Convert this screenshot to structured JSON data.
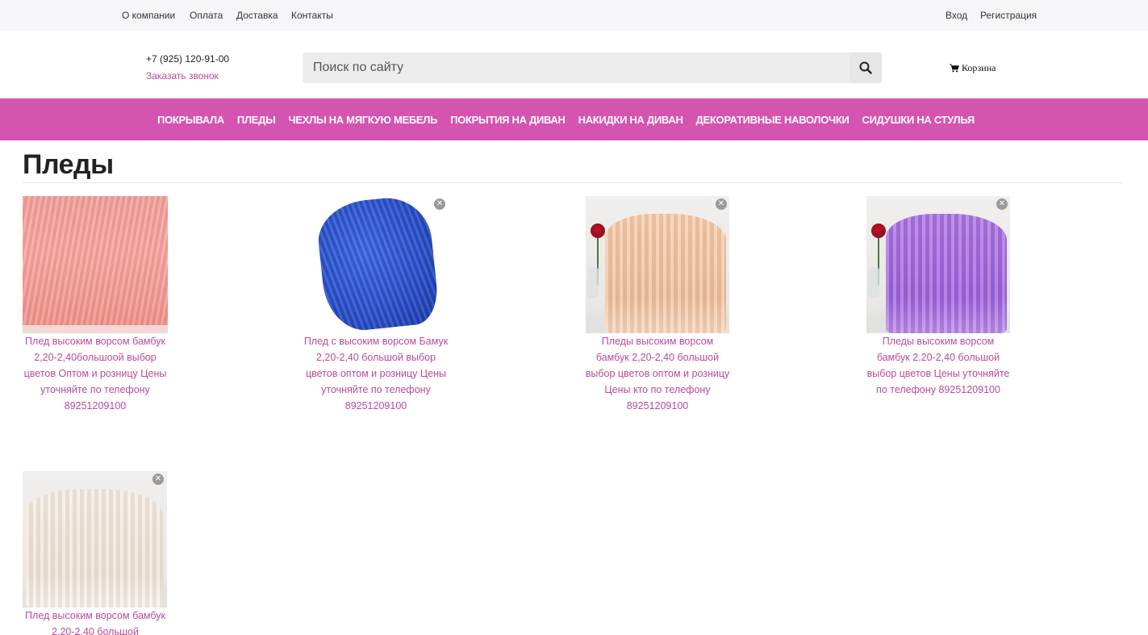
{
  "topbar": {
    "links": [
      "О компании",
      "Оплата",
      "Доставка",
      "Контакты"
    ],
    "login": "Вход",
    "register": "Регистрация"
  },
  "header": {
    "phone": "+7 (925) 120-91-00",
    "callback": "Заказать звонок",
    "search_placeholder": "Поиск по сайту",
    "cart": "Корзина"
  },
  "nav": {
    "items": [
      "ПОКРЫВАЛА",
      "ПЛЕДЫ",
      "ЧЕХЛЫ НА МЯГКУЮ МЕБЕЛЬ",
      "ПОКРЫТИЯ НА ДИВАН",
      "НАКИДКИ НА ДИВАН",
      "ДЕКОРАТИВНЫЕ НАВОЛОЧКИ",
      "СИДУШКИ НА СТУЛЬЯ"
    ]
  },
  "page": {
    "title": "Пледы"
  },
  "products": [
    {
      "caption": "Плед высоким ворсом бамбук 2,20-2,40большоой выбор цветов Оптом и розницу Цены уточняйте по телефону 89251209100",
      "image": "pink-blanket"
    },
    {
      "caption": "Плед с высоким ворсом Бамук 2,20-2,40 большой выбор цветов оптом и розницу Цены уточняйте по телефону 89251209100",
      "image": "blue-blanket"
    },
    {
      "caption": "Пледы высоким ворсом бамбук 2,20-2,40 большой выбор цветов оптом и розницу Цены кто по телефону 89251209100",
      "image": "peach-blanket"
    },
    {
      "caption": "Пледы высоким ворсом бамбук 2.20-2,40 большой выбор цветов Цены уточняйте по телефону 89251209100",
      "image": "violet-blanket"
    },
    {
      "caption": "Плед высоким ворсом бамбук 2,20-2,40 большой",
      "image": "cream-blanket"
    }
  ],
  "colors": {
    "accent": "#d454b0",
    "link": "#b94a9e",
    "topbar_bg": "#f6f6f8"
  },
  "icons": {
    "search": "search-icon",
    "cart": "cart-icon",
    "remove": "close-icon"
  }
}
